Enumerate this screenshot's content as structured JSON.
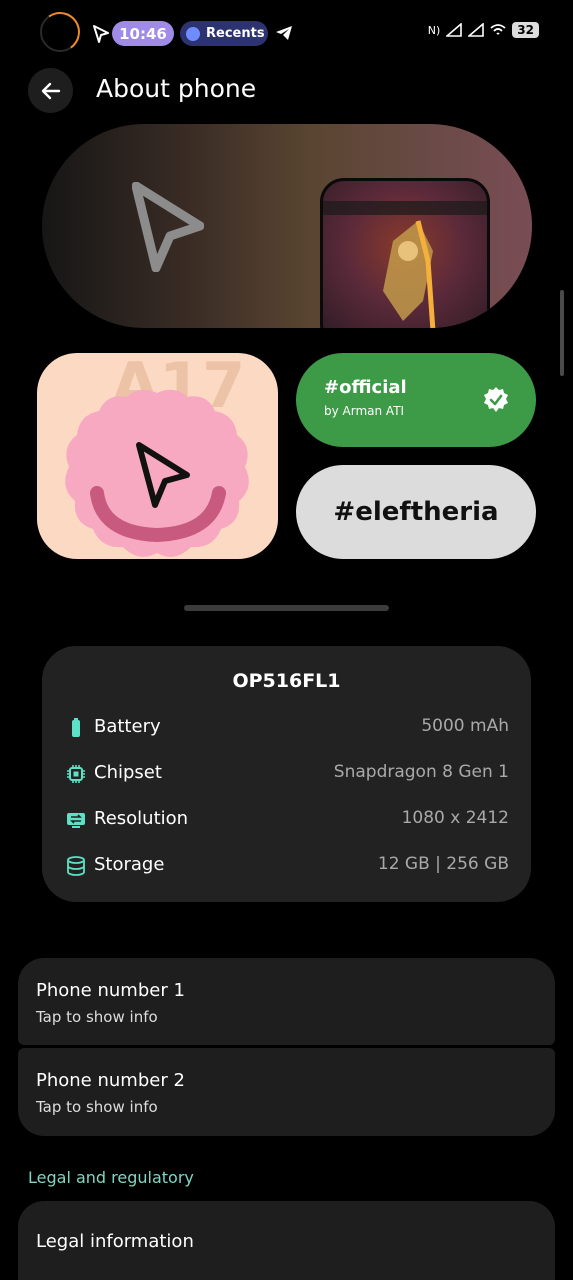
{
  "status_bar": {
    "time": "10:46",
    "recents_label": "Recents",
    "battery": "32",
    "icons": [
      "cursor-icon",
      "telegram-icon",
      "nfc-icon",
      "signal-icon",
      "wifi-icon",
      "battery-icon"
    ]
  },
  "header": {
    "title": "About phone",
    "back_icon": "arrow-left-icon"
  },
  "tiles": {
    "a17_text": "A17",
    "official_title": "#official",
    "official_by": "by Arman ATI",
    "eleftheria": "#eleftheria"
  },
  "specs": {
    "model": "OP516FL1",
    "rows": [
      {
        "label": "Battery",
        "value": "5000 mAh",
        "icon": "battery-icon"
      },
      {
        "label": "Chipset",
        "value": "Snapdragon 8 Gen 1",
        "icon": "chip-icon"
      },
      {
        "label": "Resolution",
        "value": "1080 x 2412",
        "icon": "resolution-icon"
      },
      {
        "label": "Storage",
        "value": "12 GB | 256 GB",
        "icon": "storage-icon"
      }
    ]
  },
  "phone_numbers": [
    {
      "title": "Phone number 1",
      "subtitle": "Tap to show info"
    },
    {
      "title": "Phone number 2",
      "subtitle": "Tap to show info"
    }
  ],
  "legal": {
    "section_header": "Legal and regulatory",
    "legal_information": "Legal information"
  },
  "colors": {
    "accent_teal": "#5ee0c6",
    "official_green": "#3d9b47",
    "card_bg": "#222222"
  }
}
